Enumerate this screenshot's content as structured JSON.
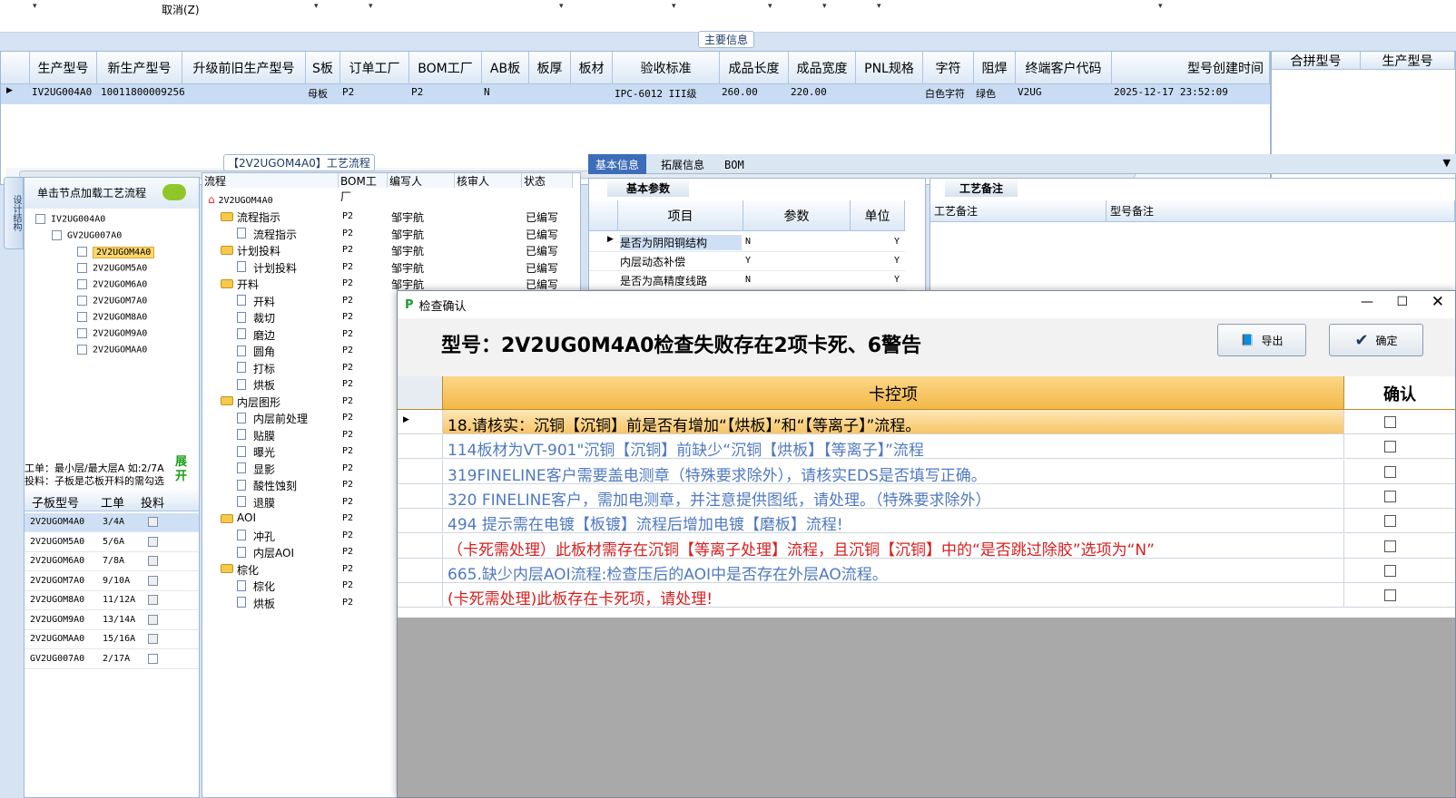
{
  "toolbar": {
    "cancel": "取消(Z)"
  },
  "main_info": {
    "legend": "主要信息",
    "columns": [
      "生产型号",
      "新生产型号",
      "升级前旧生产型号",
      "S板",
      "订单工厂",
      "BOM工厂",
      "AB板",
      "板厚",
      "板材",
      "验收标准",
      "成品长度",
      "成品宽度",
      "PNL规格",
      "字符",
      "阻焊",
      "终端客户代码",
      "型号创建时间"
    ],
    "row": {
      "prod": "IV2UG004A0",
      "newprod": "10011800009256",
      "sboard": "母板",
      "order_factory": "P2",
      "bom_factory": "P2",
      "ab": "N",
      "standard": "IPC-6012 III级",
      "length": "260.00",
      "width": "220.00",
      "char": "白色字符",
      "mask": "绿色",
      "customer": "V2UG",
      "created": "2025-12-17 23:52:09"
    },
    "side_columns": [
      "合拼型号",
      "生产型号"
    ]
  },
  "left_panel": {
    "side_tab": "设计结构",
    "load_hint": "单击节点加载工艺流程",
    "tree": [
      "IV2UG004A0",
      "GV2UG007A0",
      "2V2UGOM4A0",
      "2V2UGOM5A0",
      "2V2UGOM6A0",
      "2V2UGOM7A0",
      "2V2UGOM8A0",
      "2V2UGOM9A0",
      "2V2UGOMAA0"
    ],
    "note_line1": "工单：最小层/最大层A 如:2/7A",
    "note_line2": "投料：子板是芯板开料的需勾选",
    "expand": "展开",
    "table_headers": [
      "子板型号",
      "工单",
      "投料"
    ],
    "table_rows": [
      {
        "model": "2V2UGOM4A0",
        "wo": "3/4A"
      },
      {
        "model": "2V2UGOM5A0",
        "wo": "5/6A"
      },
      {
        "model": "2V2UGOM6A0",
        "wo": "7/8A"
      },
      {
        "model": "2V2UGOM7A0",
        "wo": "9/10A"
      },
      {
        "model": "2V2UGOM8A0",
        "wo": "11/12A"
      },
      {
        "model": "2V2UGOM9A0",
        "wo": "13/14A"
      },
      {
        "model": "2V2UGOMAA0",
        "wo": "15/16A"
      },
      {
        "model": "GV2UG007A0",
        "wo": "2/17A"
      }
    ]
  },
  "flow": {
    "title": "【2V2UGOM4A0】工艺流程",
    "headers": [
      "流程",
      "BOM工厂",
      "编写人",
      "核审人",
      "状态"
    ],
    "root": "2V2UGOM4A0",
    "rows": [
      {
        "name": "流程指示",
        "folder": true,
        "bom": "P2",
        "writer": "邹宇航",
        "status": "已编写"
      },
      {
        "name": "流程指示",
        "folder": false,
        "bom": "P2",
        "writer": "邹宇航",
        "status": "已编写"
      },
      {
        "name": "计划投料",
        "folder": true,
        "bom": "P2",
        "writer": "邹宇航",
        "status": "已编写"
      },
      {
        "name": "计划投料",
        "folder": false,
        "bom": "P2",
        "writer": "邹宇航",
        "status": "已编写"
      },
      {
        "name": "开料",
        "folder": true,
        "bom": "P2",
        "writer": "邹宇航",
        "status": "已编写"
      },
      {
        "name": "开料",
        "folder": false,
        "bom": "P2",
        "writer": "",
        "status": ""
      },
      {
        "name": "裁切",
        "folder": false,
        "bom": "P2",
        "writer": "",
        "status": ""
      },
      {
        "name": "磨边",
        "folder": false,
        "bom": "P2",
        "writer": "",
        "status": ""
      },
      {
        "name": "圆角",
        "folder": false,
        "bom": "P2",
        "writer": "",
        "status": ""
      },
      {
        "name": "打标",
        "folder": false,
        "bom": "P2",
        "writer": "",
        "status": ""
      },
      {
        "name": "烘板",
        "folder": false,
        "bom": "P2",
        "writer": "",
        "status": ""
      },
      {
        "name": "内层图形",
        "folder": true,
        "bom": "P2",
        "writer": "",
        "status": ""
      },
      {
        "name": "内层前处理",
        "folder": false,
        "bom": "P2",
        "writer": "",
        "status": ""
      },
      {
        "name": "贴膜",
        "folder": false,
        "bom": "P2",
        "writer": "",
        "status": ""
      },
      {
        "name": "曝光",
        "folder": false,
        "bom": "P2",
        "writer": "",
        "status": ""
      },
      {
        "name": "显影",
        "folder": false,
        "bom": "P2",
        "writer": "",
        "status": ""
      },
      {
        "name": "酸性蚀刻",
        "folder": false,
        "bom": "P2",
        "writer": "",
        "status": ""
      },
      {
        "name": "退膜",
        "folder": false,
        "bom": "P2",
        "writer": "",
        "status": ""
      },
      {
        "name": "AOI",
        "folder": true,
        "bom": "P2",
        "writer": "",
        "status": ""
      },
      {
        "name": "冲孔",
        "folder": false,
        "bom": "P2",
        "writer": "",
        "status": ""
      },
      {
        "name": "内层AOI",
        "folder": false,
        "bom": "P2",
        "writer": "",
        "status": ""
      },
      {
        "name": "棕化",
        "folder": true,
        "bom": "P2",
        "writer": "",
        "status": ""
      },
      {
        "name": "棕化",
        "folder": false,
        "bom": "P2",
        "writer": "",
        "status": ""
      },
      {
        "name": "烘板",
        "folder": false,
        "bom": "P2",
        "writer": "",
        "status": ""
      }
    ]
  },
  "tabs": [
    "基本信息",
    "拓展信息",
    "BOM"
  ],
  "basic": {
    "subtab": "基本参数",
    "headers": [
      "项目",
      "参数",
      "单位"
    ],
    "rows": [
      {
        "item": "是否为阴阳铜结构",
        "param": "N",
        "flag": "Y"
      },
      {
        "item": "内层动态补偿",
        "param": "Y",
        "flag": "Y"
      },
      {
        "item": "是否为高精度线路",
        "param": "N",
        "flag": "Y"
      }
    ]
  },
  "notes": {
    "subtab": "工艺备注",
    "headers": [
      "工艺备注",
      "型号备注"
    ]
  },
  "dialog": {
    "title": "检查确认",
    "headline": "型号：2V2UG0M4A0检查失败存在2项卡死、6警告",
    "export": "导出",
    "confirm": "确定",
    "col_item": "卡控项",
    "col_confirm": "确认",
    "rows": [
      {
        "text": "18.请核实：沉铜【沉铜】前是否有增加“【烘板】”和“【等离子】”流程。",
        "color": "black"
      },
      {
        "text": "114板材为VT-901\"沉铜【沉铜】前缺少“沉铜【烘板】【等离子】”流程",
        "color": "blue"
      },
      {
        "text": "319FINELINE客户需要盖电测章（特殊要求除外），请核实EDS是否填写正确。",
        "color": "blue"
      },
      {
        "text": "320 FINELINE客户，需加电测章，并注意提供图纸，请处理。（特殊要求除外）",
        "color": "blue"
      },
      {
        "text": "494 提示需在电镀【板镀】流程后增加电镀【磨板】流程!",
        "color": "blue"
      },
      {
        "text": "（卡死需处理）此板材需存在沉铜【等离子处理】流程，且沉铜【沉铜】中的“是否跳过除胶”选项为“N”",
        "color": "red"
      },
      {
        "text": "665.缺少内层AOI流程:检查压后的AOI中是否存在外层AO流程。",
        "color": "blue"
      },
      {
        "text": "(卡死需处理)此板存在卡死项，请处理!",
        "color": "red"
      }
    ]
  }
}
